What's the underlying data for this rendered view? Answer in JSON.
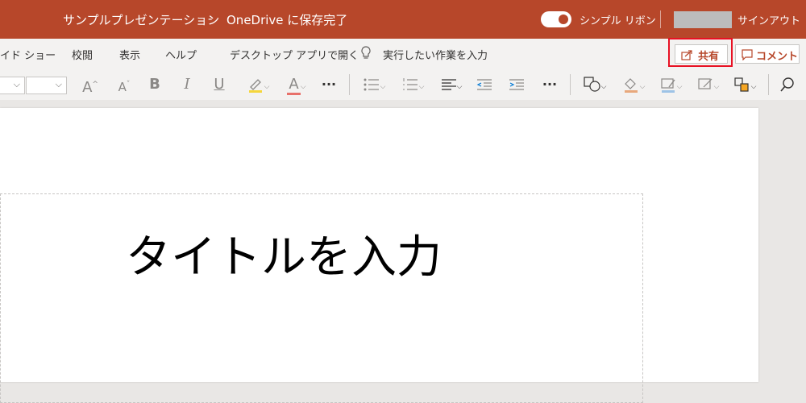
{
  "titlebar": {
    "doc_title": "サンプルプレゼンテーション",
    "separator": "-",
    "save_status": "OneDrive に保存完了",
    "toggle_label": "シンプル リボン",
    "signout_label": "サインアウト"
  },
  "menu": {
    "items": [
      "イド ショー",
      "校閲",
      "表示",
      "ヘルプ",
      "デスクトップ アプリで開く"
    ],
    "tell_me": "実行したい作業を入力",
    "share_label": "共有",
    "comment_label": "コメント"
  },
  "toolbar": {
    "font_grow": "A",
    "font_shrink": "A",
    "bold": "B",
    "italic": "I",
    "underline": "U",
    "font_color_letter": "A",
    "more": "···"
  },
  "slide": {
    "title": "タイトルを入力"
  },
  "colors": {
    "accent": "#b7472a",
    "highlight_box": "#e81123"
  }
}
